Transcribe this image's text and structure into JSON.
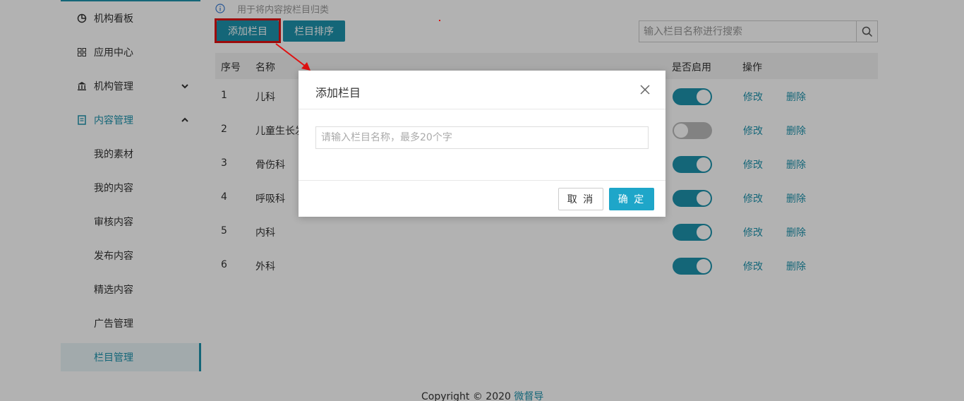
{
  "sidebar": {
    "items": [
      {
        "label": "机构看板",
        "icon": "pie-chart-icon"
      },
      {
        "label": "应用中心",
        "icon": "grid-icon"
      },
      {
        "label": "机构管理",
        "icon": "bank-icon"
      },
      {
        "label": "内容管理",
        "icon": "document-icon"
      }
    ],
    "sub_items": [
      {
        "label": "我的素材"
      },
      {
        "label": "我的内容"
      },
      {
        "label": "审核内容"
      },
      {
        "label": "发布内容"
      },
      {
        "label": "精选内容"
      },
      {
        "label": "广告管理"
      },
      {
        "label": "栏目管理"
      }
    ]
  },
  "main": {
    "hint": "用于将内容按栏目归类",
    "add_button": "添加栏目",
    "sort_button": "栏目排序",
    "search_placeholder": "输入栏目名称进行搜索",
    "table": {
      "headers": {
        "index": "序号",
        "name": "名称",
        "enabled": "是否启用",
        "actions": "操作"
      },
      "rows": [
        {
          "index": "1",
          "name": "儿科",
          "enabled": true
        },
        {
          "index": "2",
          "name": "儿童生长发育",
          "enabled": false
        },
        {
          "index": "3",
          "name": "骨伤科",
          "enabled": true
        },
        {
          "index": "4",
          "name": "呼吸科",
          "enabled": true
        },
        {
          "index": "5",
          "name": "内科",
          "enabled": true
        },
        {
          "index": "6",
          "name": "外科",
          "enabled": true
        }
      ],
      "edit_label": "修改",
      "delete_label": "删除"
    }
  },
  "footer": {
    "copyright": "Copyright © 2020",
    "brand": "微督导"
  },
  "modal": {
    "title": "添加栏目",
    "input_placeholder": "请输入栏目名称，最多20个字",
    "cancel_label": "取 消",
    "ok_label": "确 定"
  },
  "colors": {
    "primary": "#1e93ad",
    "ok_button": "#1ea6c9",
    "annotation": "#e01010"
  }
}
